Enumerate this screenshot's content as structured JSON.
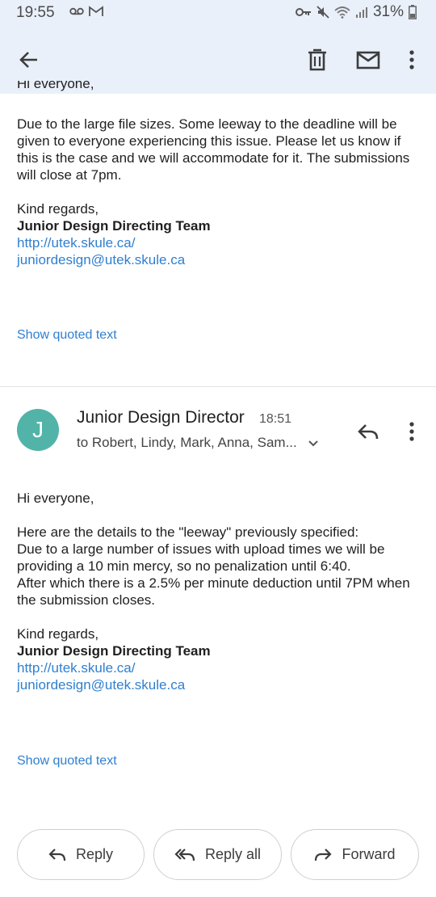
{
  "status": {
    "time": "19:55",
    "battery": "31%"
  },
  "first_message": {
    "partial_greeting": "Hi everyone,",
    "paragraph": "Due to the large file sizes. Some leeway to the deadline will be given to everyone experiencing this issue. Please let us know if this is the case and we will accommodate for it. The submissions will close at 7pm.",
    "signoff": "Kind regards,",
    "team": "Junior Design Directing Team",
    "link_url": "http://utek.skule.ca/",
    "link_email": "juniordesign@utek.skule.ca",
    "show_quoted": "Show quoted text"
  },
  "second_message": {
    "avatar_letter": "J",
    "sender": "Junior Design Director",
    "time": "18:51",
    "recipients": "to Robert, Lindy, Mark, Anna, Sam...",
    "greeting": "Hi everyone,",
    "line1": "Here are the details to the \"leeway\" previously specified:",
    "line2": "Due to a large number of issues with upload times we will be providing a 10 min mercy, so no penalization until 6:40.",
    "line3": "After which there is a 2.5% per minute deduction until 7PM when the submission closes.",
    "signoff": "Kind regards,",
    "team": "Junior Design Directing Team",
    "link_url": "http://utek.skule.ca/",
    "link_email": "juniordesign@utek.skule.ca",
    "show_quoted": "Show quoted text"
  },
  "actions": {
    "reply": "Reply",
    "reply_all": "Reply all",
    "forward": "Forward"
  },
  "colors": {
    "accent_link": "#2f7fd0",
    "avatar": "#52b3a8",
    "app_bar": "#e9f0fa"
  }
}
